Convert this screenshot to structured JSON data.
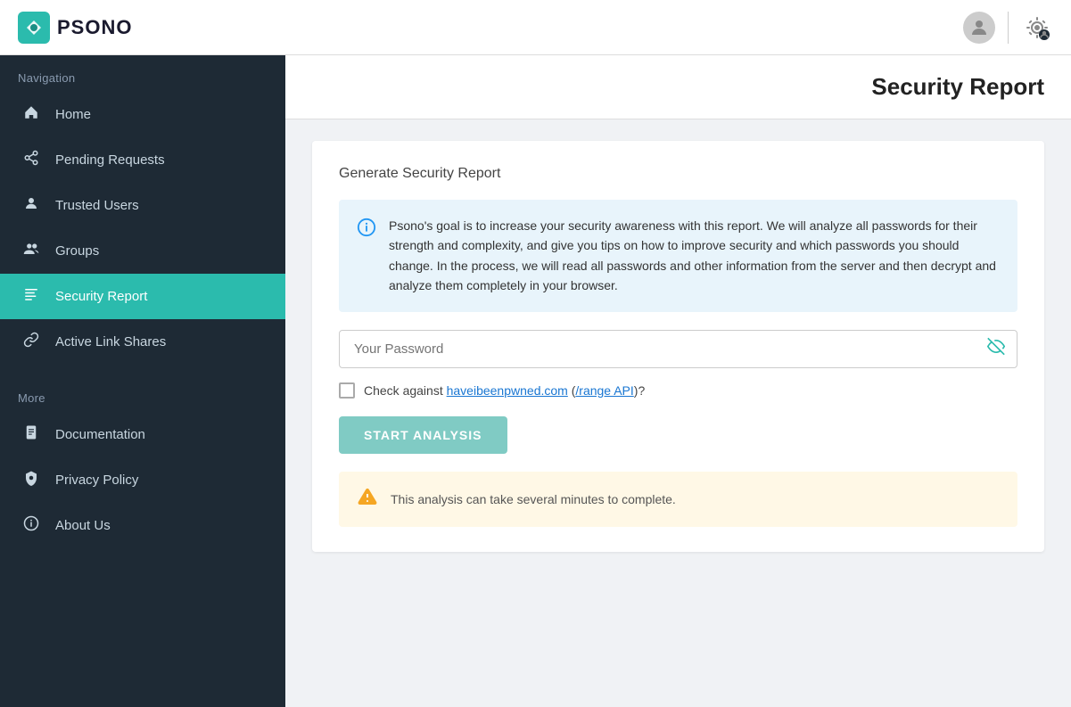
{
  "header": {
    "logo_text": "PSONO",
    "user_icon": "👤",
    "settings_icon": "⚙"
  },
  "sidebar": {
    "nav_label": "Navigation",
    "items": [
      {
        "id": "home",
        "icon": "🏠",
        "label": "Home",
        "active": false
      },
      {
        "id": "pending-requests",
        "icon": "◁",
        "label": "Pending Requests",
        "active": false
      },
      {
        "id": "trusted-users",
        "icon": "👤",
        "label": "Trusted Users",
        "active": false
      },
      {
        "id": "groups",
        "icon": "👥",
        "label": "Groups",
        "active": false
      },
      {
        "id": "security-report",
        "icon": "≡",
        "label": "Security Report",
        "active": true
      },
      {
        "id": "active-link-shares",
        "icon": "🔗",
        "label": "Active Link Shares",
        "active": false
      }
    ],
    "more_label": "More",
    "more_items": [
      {
        "id": "documentation",
        "icon": "📄",
        "label": "Documentation",
        "active": false
      },
      {
        "id": "privacy-policy",
        "icon": "🪙",
        "label": "Privacy Policy",
        "active": false
      },
      {
        "id": "about-us",
        "icon": "ℹ",
        "label": "About Us",
        "active": false
      }
    ]
  },
  "main": {
    "page_title": "Security Report",
    "card_title": "Generate Security Report",
    "info_text": "Psono's goal is to increase your security awareness with this report. We will analyze all passwords for their strength and complexity, and give you tips on how to improve security and which passwords you should change. In the process, we will read all passwords and other information from the server and then decrypt and analyze them completely in your browser.",
    "password_placeholder": "Your Password",
    "checkbox_label_pre": "Check against ",
    "checkbox_link1_text": "haveibeenpwned.com",
    "checkbox_link1_href": "#",
    "checkbox_label_mid": " (",
    "checkbox_link2_text": "/range API",
    "checkbox_link2_href": "#",
    "checkbox_label_post": ")?",
    "start_button_label": "START ANALYSIS",
    "warning_text": "This analysis can take several minutes to complete."
  },
  "colors": {
    "accent": "#2bbbad",
    "sidebar_bg": "#1e2a35",
    "info_bg": "#e8f4fb",
    "warning_bg": "#fff8e6",
    "info_icon": "#2196f3",
    "warning_icon": "#f5a623",
    "btn_color": "#80cbc4"
  }
}
